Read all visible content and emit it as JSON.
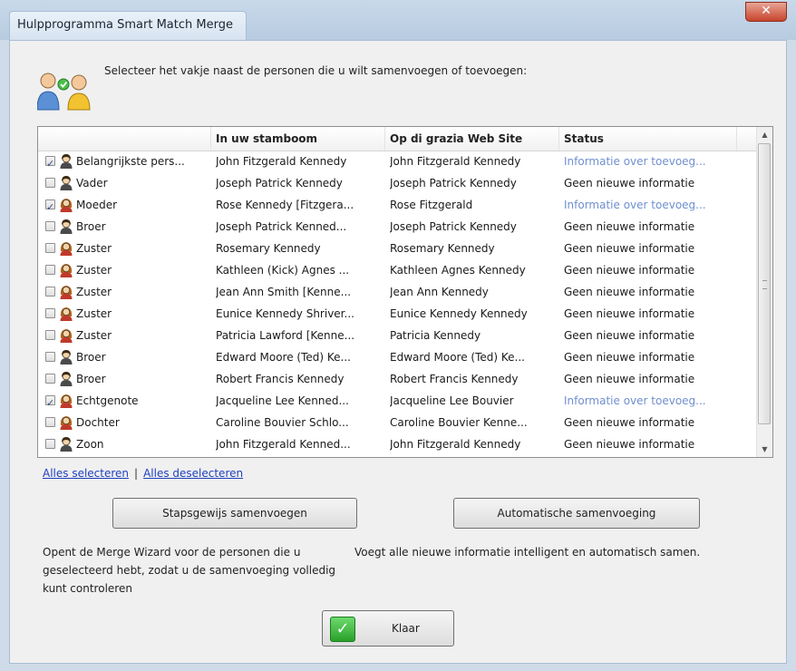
{
  "window": {
    "title": "Hulpprogramma Smart Match Merge",
    "close_glyph": "✕"
  },
  "instruction": "Selecteer het vakje naast de personen die u wilt samenvoegen of toevoegen:",
  "header_icon": "two-people-merge-icon",
  "colors": {
    "titlebar": "#c0d3e6",
    "link": "#1f3fbf",
    "status_link": "#6f8fd0",
    "done_green": "#2aa12a"
  },
  "grid": {
    "columns": [
      "",
      "In uw stamboom",
      "Op di grazia Web Site",
      "Status"
    ],
    "rows": [
      {
        "checked": true,
        "gender": "male",
        "relation": "Belangrijkste pers...",
        "tree": "John Fitzgerald Kennedy",
        "site": "John Fitzgerald Kennedy",
        "status": "Informatie over toevoeg...",
        "status_link": true
      },
      {
        "checked": false,
        "gender": "male",
        "relation": "Vader",
        "tree": "Joseph Patrick Kennedy",
        "site": "Joseph Patrick Kennedy",
        "status": "Geen nieuwe informatie",
        "status_link": false
      },
      {
        "checked": true,
        "gender": "female",
        "relation": "Moeder",
        "tree": "Rose Kennedy [Fitzgera...",
        "site": "Rose Fitzgerald",
        "status": "Informatie over toevoeg...",
        "status_link": true
      },
      {
        "checked": false,
        "gender": "male",
        "relation": "Broer",
        "tree": "Joseph Patrick Kenned...",
        "site": "Joseph Patrick Kennedy",
        "status": "Geen nieuwe informatie",
        "status_link": false
      },
      {
        "checked": false,
        "gender": "female",
        "relation": "Zuster",
        "tree": "Rosemary Kennedy",
        "site": "Rosemary Kennedy",
        "status": "Geen nieuwe informatie",
        "status_link": false
      },
      {
        "checked": false,
        "gender": "female",
        "relation": "Zuster",
        "tree": "Kathleen (Kick) Agnes ...",
        "site": "Kathleen Agnes Kennedy",
        "status": "Geen nieuwe informatie",
        "status_link": false
      },
      {
        "checked": false,
        "gender": "female",
        "relation": "Zuster",
        "tree": "Jean Ann Smith [Kenne...",
        "site": "Jean Ann Kennedy",
        "status": "Geen nieuwe informatie",
        "status_link": false
      },
      {
        "checked": false,
        "gender": "female",
        "relation": "Zuster",
        "tree": "Eunice Kennedy Shriver...",
        "site": "Eunice Kennedy Kennedy",
        "status": "Geen nieuwe informatie",
        "status_link": false
      },
      {
        "checked": false,
        "gender": "female",
        "relation": "Zuster",
        "tree": "Patricia Lawford [Kenne...",
        "site": "Patricia Kennedy",
        "status": "Geen nieuwe informatie",
        "status_link": false
      },
      {
        "checked": false,
        "gender": "male",
        "relation": "Broer",
        "tree": "Edward Moore (Ted) Ke...",
        "site": "Edward Moore (Ted) Ke...",
        "status": "Geen nieuwe informatie",
        "status_link": false
      },
      {
        "checked": false,
        "gender": "male",
        "relation": "Broer",
        "tree": "Robert Francis Kennedy",
        "site": "Robert Francis Kennedy",
        "status": "Geen nieuwe informatie",
        "status_link": false
      },
      {
        "checked": true,
        "gender": "female",
        "relation": "Echtgenote",
        "tree": "Jacqueline Lee Kenned...",
        "site": "Jacqueline Lee Bouvier",
        "status": "Informatie over toevoeg...",
        "status_link": true
      },
      {
        "checked": false,
        "gender": "female",
        "relation": "Dochter",
        "tree": "Caroline Bouvier Schlo...",
        "site": "Caroline Bouvier Kenne...",
        "status": "Geen nieuwe informatie",
        "status_link": false
      },
      {
        "checked": false,
        "gender": "male",
        "relation": "Zoon",
        "tree": "John Fitzgerald Kenned...",
        "site": "John Fitzgerald Kennedy",
        "status": "Geen nieuwe informatie",
        "status_link": false
      }
    ]
  },
  "links": {
    "select_all": "Alles selecteren",
    "separator": "|",
    "deselect_all": "Alles deselecteren"
  },
  "buttons": {
    "step_merge": "Stapsgewijs samenvoegen",
    "auto_merge": "Automatische samenvoeging",
    "done": "Klaar"
  },
  "descriptions": {
    "step": "Opent de Merge Wizard voor de personen die u geselecteerd hebt, zodat u de samenvoeging volledig kunt controleren",
    "auto": "Voegt alle nieuwe informatie intelligent en automatisch samen."
  }
}
